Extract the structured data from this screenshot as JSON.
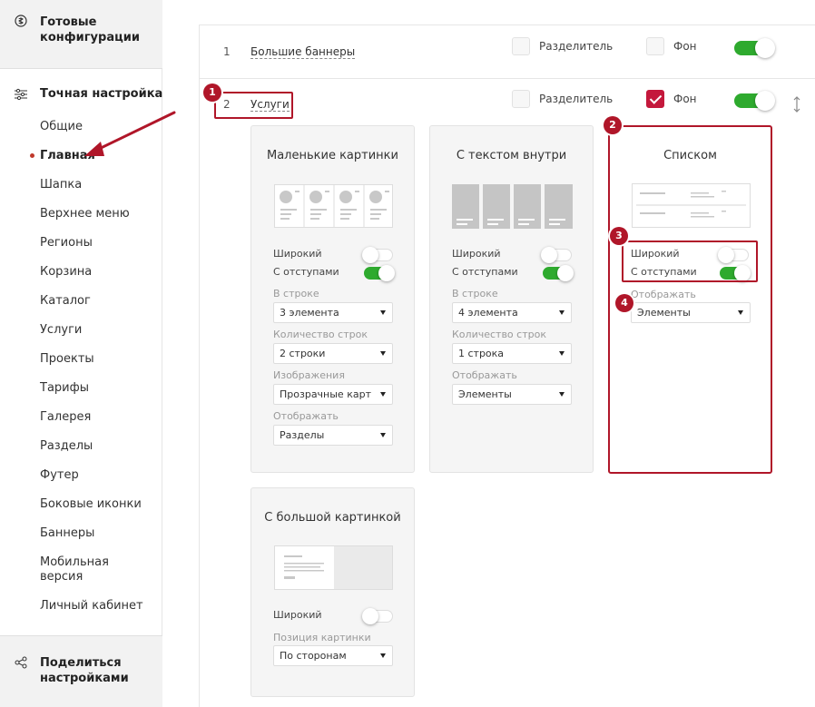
{
  "sidebar": {
    "top_label": "Готовые конфигурации",
    "section_label": "Точная настройка",
    "items": [
      "Общие",
      "Главная",
      "Шапка",
      "Верхнее меню",
      "Регионы",
      "Корзина",
      "Каталог",
      "Услуги",
      "Проекты",
      "Тарифы",
      "Галерея",
      "Разделы",
      "Футер",
      "Боковые иконки",
      "Баннеры",
      "Мобильная версия",
      "Личный кабинет"
    ],
    "active_item": "Главная",
    "bottom_label": "Поделиться настройками"
  },
  "rows": [
    {
      "num": "1",
      "name": "Большие баннеры",
      "divider_label": "Разделитель",
      "divider_checked": false,
      "bg_label": "Фон",
      "bg_checked": false,
      "enabled": true
    },
    {
      "num": "2",
      "name": "Услуги",
      "divider_label": "Разделитель",
      "divider_checked": false,
      "bg_label": "Фон",
      "bg_checked": true,
      "enabled": true
    }
  ],
  "cards": {
    "small": {
      "title": "Маленькие картинки",
      "wide_label": "Широкий",
      "wide_on": false,
      "indent_label": "С отступами",
      "indent_on": true,
      "per_row_label": "В строке",
      "per_row_value": "3 элемента",
      "rows_label": "Количество строк",
      "rows_value": "2 строки",
      "images_label": "Изображения",
      "images_value": "Прозрачные картинки",
      "display_label": "Отображать",
      "display_value": "Разделы"
    },
    "text_inside": {
      "title": "С текстом внутри",
      "wide_label": "Широкий",
      "wide_on": false,
      "indent_label": "С отступами",
      "indent_on": true,
      "per_row_label": "В строке",
      "per_row_value": "4 элемента",
      "rows_label": "Количество строк",
      "rows_value": "1 строка",
      "display_label": "Отображать",
      "display_value": "Элементы"
    },
    "list": {
      "title": "Списком",
      "wide_label": "Широкий",
      "wide_on": false,
      "indent_label": "С отступами",
      "indent_on": true,
      "display_label": "Отображать",
      "display_value": "Элементы"
    },
    "big_image": {
      "title": "С большой картинкой",
      "wide_label": "Широкий",
      "wide_on": false,
      "position_label": "Позиция картинки",
      "position_value": "По сторонам"
    }
  },
  "annotations": [
    "1",
    "2",
    "3",
    "4"
  ],
  "colors": {
    "accent": "#c4183c",
    "highlight": "#b01629",
    "toggle_on": "#2eaa2e"
  },
  "icons": [
    "configurations-icon",
    "sliders-icon",
    "share-icon",
    "drag-handle-icon",
    "checkmark-icon",
    "chevron-down-icon"
  ]
}
